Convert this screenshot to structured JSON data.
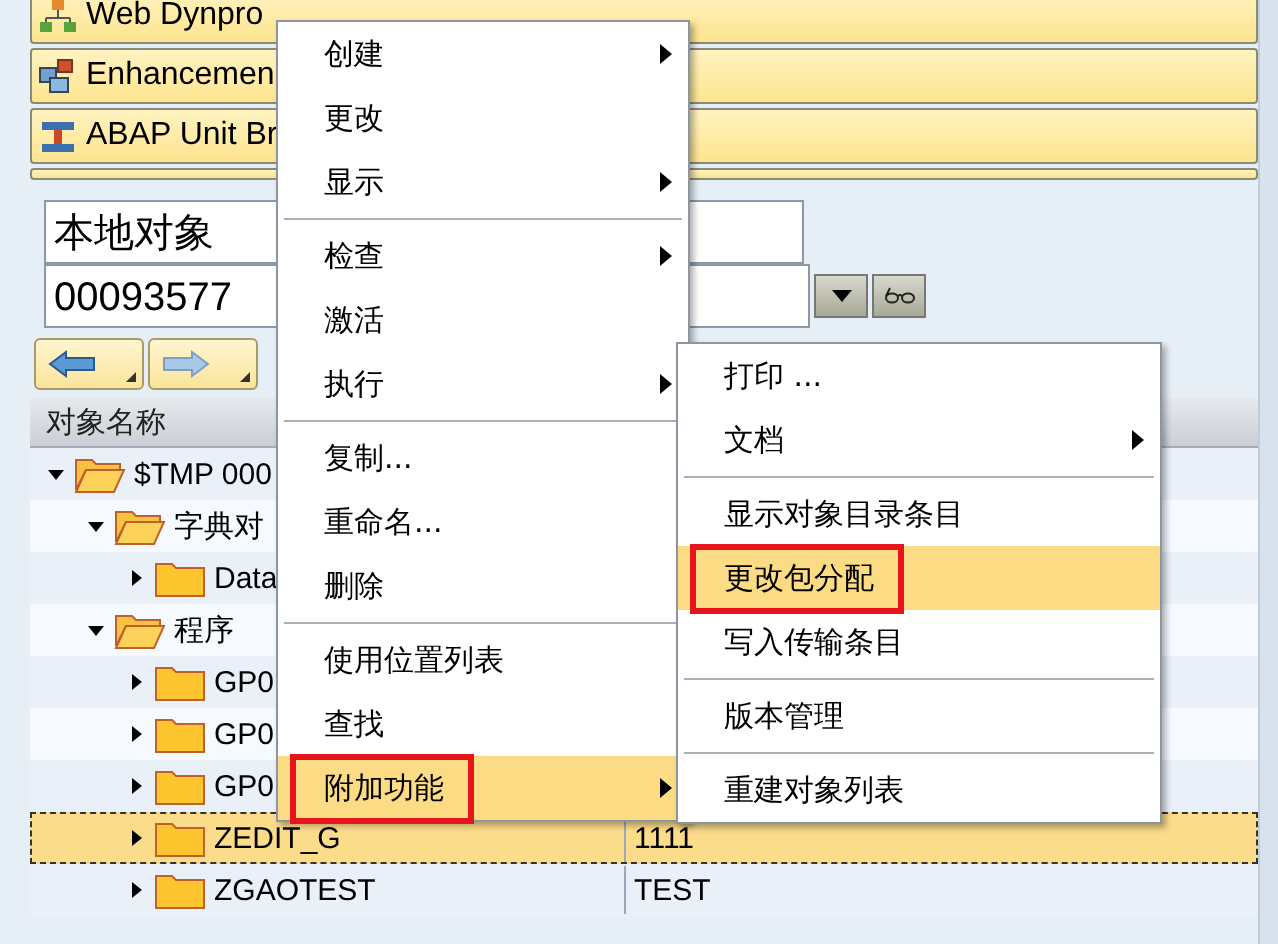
{
  "toolbar_buttons": [
    {
      "label": "Web Dynpro",
      "kind": "hierarchy"
    },
    {
      "label": "Enhancemen",
      "kind": "blocks"
    },
    {
      "label": "ABAP Unit Br",
      "kind": "tool"
    },
    {
      "kind": "cutoff"
    }
  ],
  "object_type_field": {
    "value": "本地对象"
  },
  "object_name_field": {
    "value": "00093577"
  },
  "table": {
    "columns": [
      "对象名称"
    ],
    "rows": [
      {
        "label": "$TMP 000",
        "expanded": true,
        "selected": false,
        "children": [
          {
            "label": "字典对",
            "expanded": true,
            "selected": false,
            "children": [
              {
                "label": "Data",
                "expanded": false,
                "selected": false
              }
            ]
          },
          {
            "label": "程序",
            "expanded": true,
            "selected": false,
            "children": [
              {
                "label": "GP0",
                "expanded": false,
                "selected": false
              },
              {
                "label": "GP0",
                "expanded": false,
                "selected": false
              },
              {
                "label": "GP0",
                "expanded": false,
                "selected": false
              },
              {
                "label": "ZEDIT_G",
                "value": "1111",
                "expanded": false,
                "selected": true
              },
              {
                "label": "ZGAOTEST",
                "value": "TEST",
                "expanded": false,
                "selected": false
              }
            ]
          }
        ]
      }
    ]
  },
  "context_menu": {
    "groups": [
      [
        {
          "label": "创建",
          "submenu": true,
          "selected": false,
          "annotated": false
        },
        {
          "label": "更改",
          "submenu": false,
          "selected": false,
          "annotated": false
        },
        {
          "label": "显示",
          "submenu": true,
          "selected": false,
          "annotated": false
        }
      ],
      [
        {
          "label": "检查",
          "submenu": true,
          "selected": false,
          "annotated": false
        },
        {
          "label": "激活",
          "submenu": false,
          "selected": false,
          "annotated": false
        },
        {
          "label": "执行",
          "submenu": true,
          "selected": false,
          "annotated": false
        }
      ],
      [
        {
          "label": "复制...",
          "submenu": false,
          "selected": false,
          "annotated": false
        },
        {
          "label": "重命名...",
          "submenu": false,
          "selected": false,
          "annotated": false
        },
        {
          "label": "删除",
          "submenu": false,
          "selected": false,
          "annotated": false
        }
      ],
      [
        {
          "label": "使用位置列表",
          "submenu": false,
          "selected": false,
          "annotated": false
        },
        {
          "label": "查找",
          "submenu": false,
          "selected": false,
          "annotated": false
        },
        {
          "label": "附加功能",
          "submenu": true,
          "selected": true,
          "annotated": true
        }
      ]
    ]
  },
  "submenu": {
    "groups": [
      [
        {
          "label": "打印 ...",
          "submenu": false,
          "selected": false,
          "annotated": false
        },
        {
          "label": "文档",
          "submenu": true,
          "selected": false,
          "annotated": false
        }
      ],
      [
        {
          "label": "显示对象目录条目",
          "submenu": false,
          "selected": false,
          "annotated": false
        },
        {
          "label": "更改包分配",
          "submenu": false,
          "selected": true,
          "annotated": true
        },
        {
          "label": "写入传输条目",
          "submenu": false,
          "selected": false,
          "annotated": false
        }
      ],
      [
        {
          "label": "版本管理",
          "submenu": false,
          "selected": false,
          "annotated": false
        }
      ],
      [
        {
          "label": "重建对象列表",
          "submenu": false,
          "selected": false,
          "annotated": false
        }
      ]
    ]
  }
}
